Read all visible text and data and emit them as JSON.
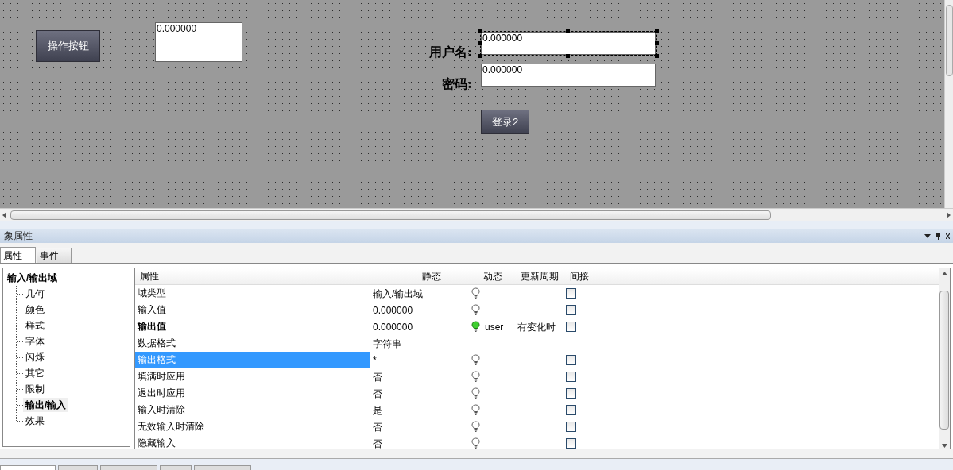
{
  "canvas": {
    "action_button": {
      "label": "操作按钮"
    },
    "display_field": {
      "value": "0.000000"
    },
    "username": {
      "label": "用户名:",
      "value": "0.000000",
      "selected": true
    },
    "password": {
      "label": "密码:",
      "value": "0.000000",
      "selected": false
    },
    "login_button": {
      "label": "登录2"
    }
  },
  "panel": {
    "title": "象属性"
  },
  "bottom_tabs": [
    {
      "selected": true
    },
    {
      "selected": false
    },
    {
      "selected": false
    },
    {
      "selected": false
    },
    {
      "selected": false
    }
  ],
  "tabs": [
    {
      "label": "属性",
      "selected": true
    },
    {
      "label": "事件",
      "selected": false
    }
  ],
  "tree": {
    "label": "输入/输出域",
    "children": [
      {
        "label": "几何",
        "selected": false
      },
      {
        "label": "颜色",
        "selected": false
      },
      {
        "label": "样式",
        "selected": false
      },
      {
        "label": "字体",
        "selected": false
      },
      {
        "label": "闪烁",
        "selected": false
      },
      {
        "label": "其它",
        "selected": false
      },
      {
        "label": "限制",
        "selected": false
      },
      {
        "label": "输出/输入",
        "selected": true
      },
      {
        "label": "效果",
        "selected": false
      }
    ]
  },
  "table": {
    "columns": [
      "属性",
      "静态",
      "动态",
      "更新周期",
      "间接"
    ],
    "rows": [
      {
        "name": "域类型",
        "bold": false,
        "selected": false,
        "static": "输入/输出域",
        "lamp": {
          "lit": false
        },
        "indirect": {
          "checked": false
        }
      },
      {
        "name": "输入值",
        "bold": false,
        "selected": false,
        "static": "0.000000",
        "lamp": {
          "lit": false
        },
        "indirect": {
          "checked": false
        }
      },
      {
        "name": "输出值",
        "bold": true,
        "selected": false,
        "static": "0.000000",
        "lamp": {
          "lit": true
        },
        "tag": "user",
        "cycle": "有变化时",
        "indirect": {
          "checked": false
        }
      },
      {
        "name": "数据格式",
        "bold": false,
        "selected": false,
        "static": "字符串"
      },
      {
        "name": "输出格式",
        "bold": false,
        "selected": true,
        "static": "*",
        "lamp": {
          "lit": false
        },
        "indirect": {
          "checked": false
        }
      },
      {
        "name": "填满时应用",
        "bold": false,
        "selected": false,
        "static": "否",
        "lamp": {
          "lit": false
        },
        "indirect": {
          "checked": false
        }
      },
      {
        "name": "退出时应用",
        "bold": false,
        "selected": false,
        "static": "否",
        "lamp": {
          "lit": false
        },
        "indirect": {
          "checked": false
        }
      },
      {
        "name": "输入时清除",
        "bold": false,
        "selected": false,
        "static": "是",
        "lamp": {
          "lit": false
        },
        "indirect": {
          "checked": false
        }
      },
      {
        "name": "无效输入时清除",
        "bold": false,
        "selected": false,
        "static": "否",
        "lamp": {
          "lit": false
        },
        "indirect": {
          "checked": false
        }
      },
      {
        "name": "隐藏输入",
        "bold": false,
        "selected": false,
        "static": "否",
        "lamp": {
          "lit": false
        },
        "indirect": {
          "checked": false
        }
      }
    ]
  }
}
